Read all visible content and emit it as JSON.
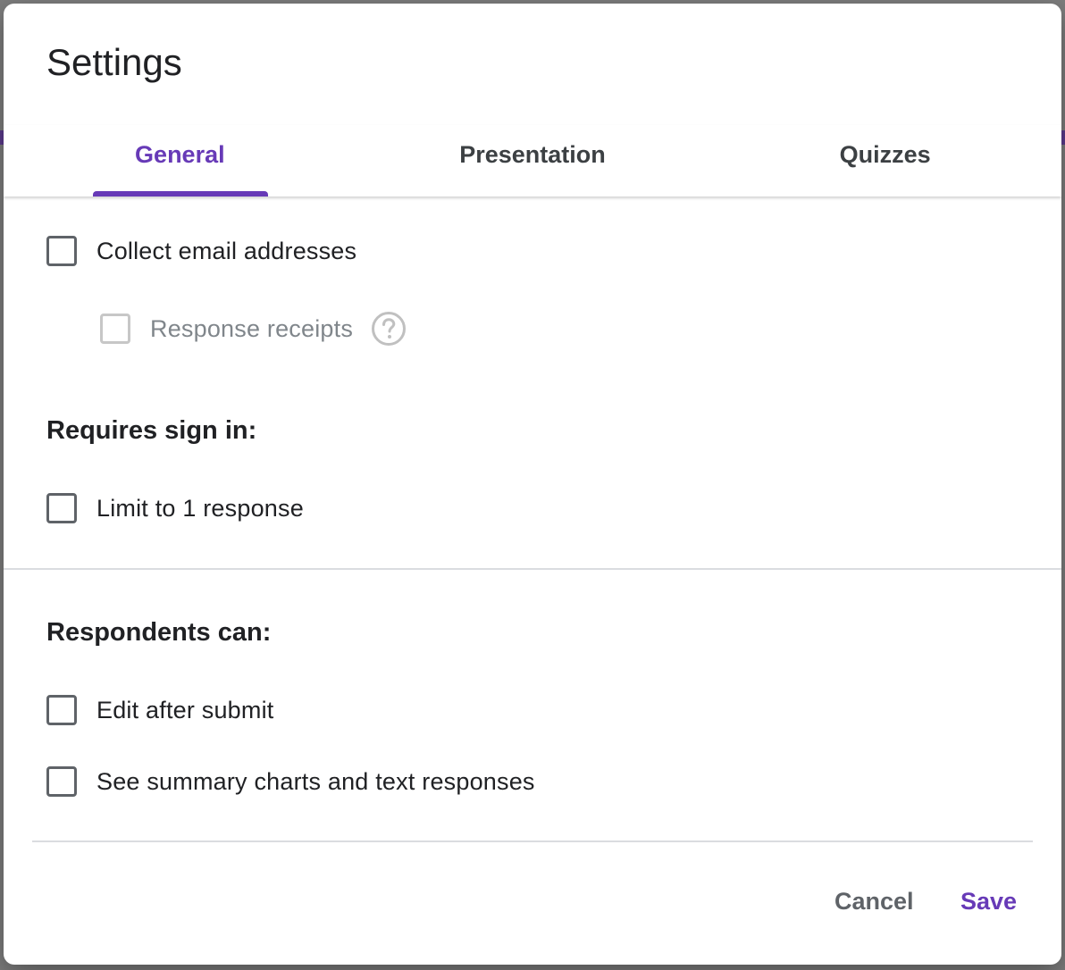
{
  "dialog": {
    "title": "Settings"
  },
  "tabs": [
    {
      "label": "General",
      "active": true
    },
    {
      "label": "Presentation",
      "active": false
    },
    {
      "label": "Quizzes",
      "active": false
    }
  ],
  "options": {
    "collect_email": {
      "label": "Collect email addresses",
      "checked": false
    },
    "response_receipts": {
      "label": "Response receipts",
      "checked": false,
      "disabled": true,
      "help_icon": "help-circle-icon"
    },
    "limit_one": {
      "label": "Limit to 1 response",
      "checked": false
    },
    "edit_after_submit": {
      "label": "Edit after submit",
      "checked": false
    },
    "see_summary": {
      "label": "See summary charts and text responses",
      "checked": false
    }
  },
  "sections": {
    "requires_sign_in": "Requires sign in:",
    "respondents_can": "Respondents can:"
  },
  "actions": {
    "cancel": "Cancel",
    "save": "Save"
  },
  "colors": {
    "accent": "#673ab7",
    "text": "#202124",
    "muted": "#5f6368"
  }
}
